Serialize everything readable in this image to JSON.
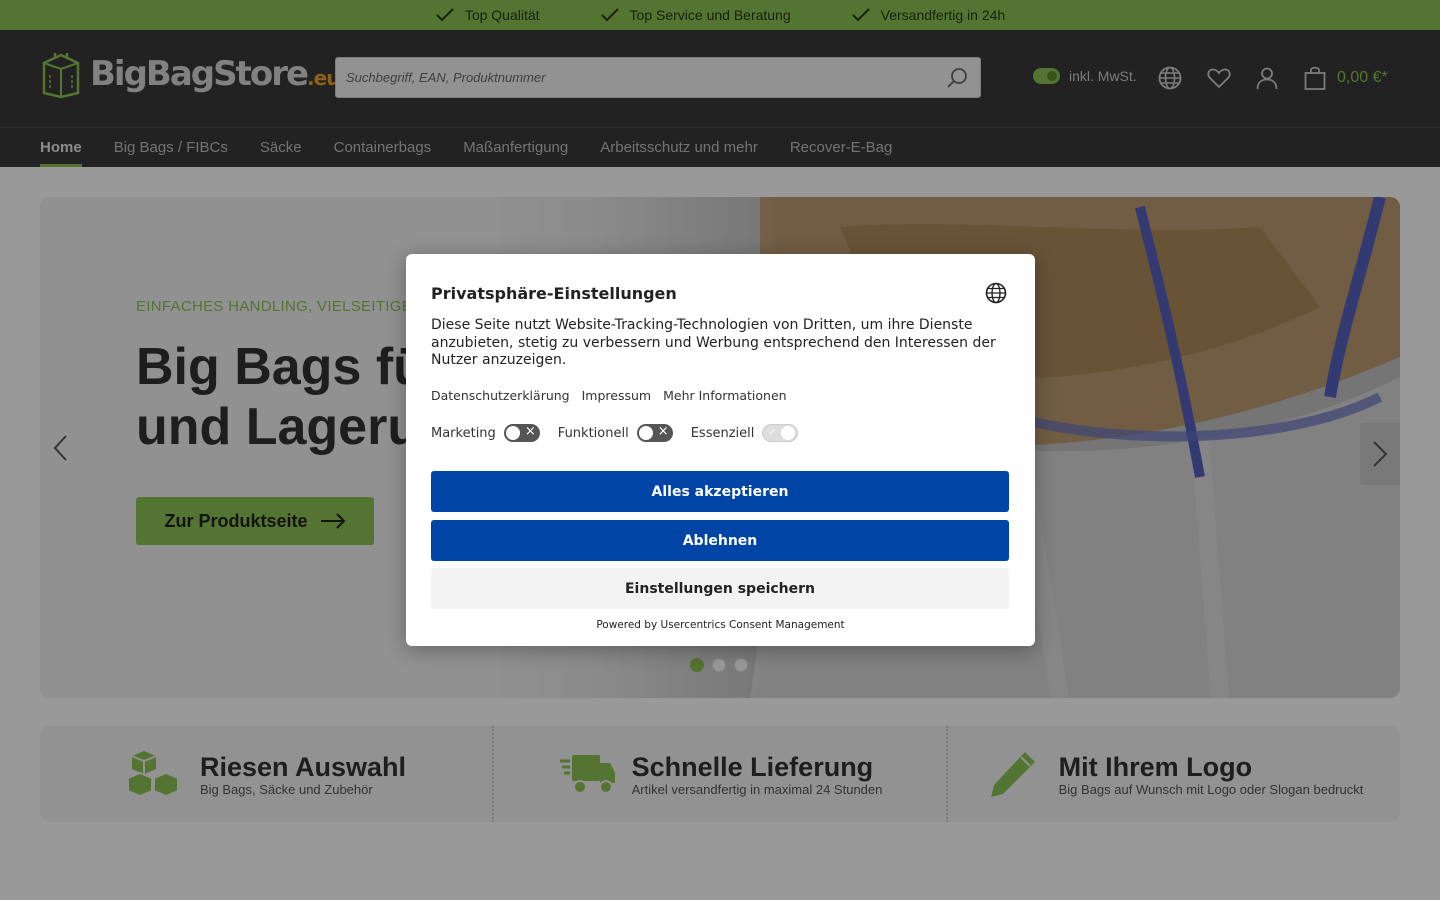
{
  "topbar": {
    "usps": [
      "Top Qualität",
      "Top Service und Beratung",
      "Versandfertig in 24h"
    ]
  },
  "header": {
    "logo_text": "BigBagStore",
    "logo_tld": ".eu",
    "search_placeholder": "Suchbegriff, EAN, Produktnummer",
    "tax_label": "inkl. MwSt.",
    "cart_total": "0,00 €*"
  },
  "nav": {
    "items": [
      "Home",
      "Big Bags / FIBCs",
      "Säcke",
      "Containerbags",
      "Maßanfertigung",
      "Arbeitsschutz und mehr",
      "Recover-E-Bag"
    ]
  },
  "hero": {
    "subtitle": "EINFACHES HANDLING, VIELSEITIGE EIN",
    "title_line1": "Big Bags fü",
    "title_line2": "und Lageru",
    "cta": "Zur Produktseite",
    "slide_count": 3,
    "active_slide": 1
  },
  "features": [
    {
      "title": "Riesen Auswahl",
      "subtitle": "Big Bags, Säcke und Zubehör"
    },
    {
      "title": "Schnelle Lieferung",
      "subtitle": "Artikel versandfertig in maximal 24 Stunden"
    },
    {
      "title": "Mit Ihrem Logo",
      "subtitle": "Big Bags auf Wunsch mit Logo oder Slogan bedruckt"
    }
  ],
  "consent": {
    "title": "Privatsphäre-Einstellungen",
    "text": "Diese Seite nutzt Website-Tracking-Technologien von Dritten, um ihre Dienste anzubieten, stetig zu verbessern und Werbung entsprechend den Interessen der Nutzer anzuzeigen.",
    "links": [
      "Datenschutzerklärung",
      "Impressum",
      "Mehr Informationen"
    ],
    "toggles": [
      {
        "label": "Marketing",
        "state": "off"
      },
      {
        "label": "Funktionell",
        "state": "off"
      },
      {
        "label": "Essenziell",
        "state": "on"
      }
    ],
    "accept_all": "Alles akzeptieren",
    "deny": "Ablehnen",
    "save": "Einstellungen speichern",
    "powered_by": "Powered by Usercentrics Consent Management"
  },
  "colors": {
    "brand_green": "#8cc152",
    "header_dark": "#3a3a3a",
    "consent_blue": "#0045a5"
  }
}
